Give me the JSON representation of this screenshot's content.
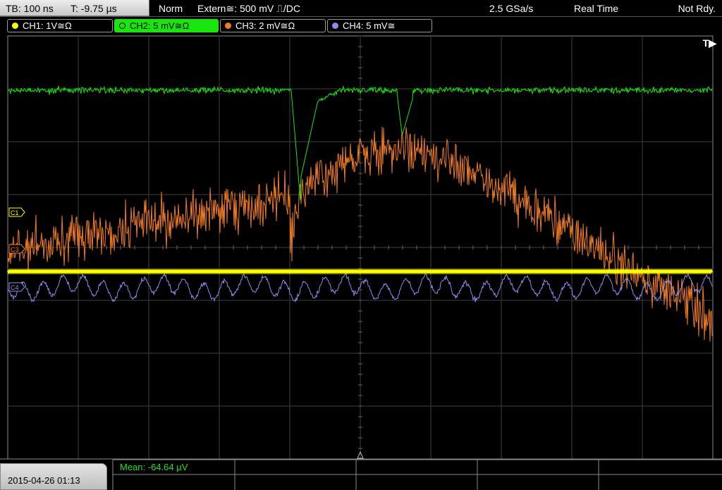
{
  "status_bar": {
    "timebase": "TB: 100 ns",
    "trigger_position": "T: -9.75 µs",
    "trigger_mode": "Norm",
    "trigger_source": "Extern≅: 500 mV ⎍/DC",
    "sample_rate": "2.5 GSa/s",
    "acquisition": "Real Time",
    "status": "Not Rdy."
  },
  "channels": [
    {
      "label": "CH1: 1V≅Ω",
      "color": "#ffff00",
      "marker": "C1"
    },
    {
      "label": "CH2: 5 mV≅Ω",
      "color": "#19e60e",
      "marker": "C2"
    },
    {
      "label": "CH3: 2 mV≅Ω",
      "color": "#f07b22",
      "marker": "C3"
    },
    {
      "label": "CH4: 5 mV≅",
      "color": "#8c8cf0",
      "marker": "C4"
    }
  ],
  "trigger_marker": "T▶",
  "date_time": "2015-04-26 01:13",
  "measurement": "Mean: -64.64 µV",
  "colors": {
    "grid": "#3f3f3f",
    "frame": "#8a8a8a",
    "active_tab": "#19e60e"
  }
}
